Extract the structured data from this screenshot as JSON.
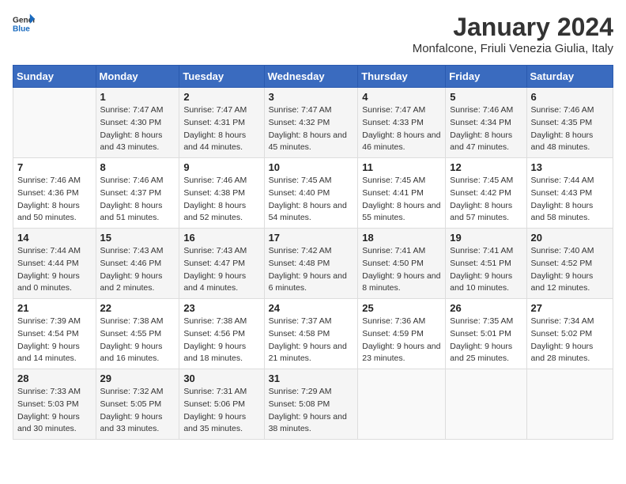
{
  "header": {
    "logo_general": "General",
    "logo_blue": "Blue",
    "title": "January 2024",
    "subtitle": "Monfalcone, Friuli Venezia Giulia, Italy"
  },
  "weekdays": [
    "Sunday",
    "Monday",
    "Tuesday",
    "Wednesday",
    "Thursday",
    "Friday",
    "Saturday"
  ],
  "weeks": [
    [
      {
        "day": "",
        "sunrise": "",
        "sunset": "",
        "daylight": ""
      },
      {
        "day": "1",
        "sunrise": "Sunrise: 7:47 AM",
        "sunset": "Sunset: 4:30 PM",
        "daylight": "Daylight: 8 hours and 43 minutes."
      },
      {
        "day": "2",
        "sunrise": "Sunrise: 7:47 AM",
        "sunset": "Sunset: 4:31 PM",
        "daylight": "Daylight: 8 hours and 44 minutes."
      },
      {
        "day": "3",
        "sunrise": "Sunrise: 7:47 AM",
        "sunset": "Sunset: 4:32 PM",
        "daylight": "Daylight: 8 hours and 45 minutes."
      },
      {
        "day": "4",
        "sunrise": "Sunrise: 7:47 AM",
        "sunset": "Sunset: 4:33 PM",
        "daylight": "Daylight: 8 hours and 46 minutes."
      },
      {
        "day": "5",
        "sunrise": "Sunrise: 7:46 AM",
        "sunset": "Sunset: 4:34 PM",
        "daylight": "Daylight: 8 hours and 47 minutes."
      },
      {
        "day": "6",
        "sunrise": "Sunrise: 7:46 AM",
        "sunset": "Sunset: 4:35 PM",
        "daylight": "Daylight: 8 hours and 48 minutes."
      }
    ],
    [
      {
        "day": "7",
        "sunrise": "Sunrise: 7:46 AM",
        "sunset": "Sunset: 4:36 PM",
        "daylight": "Daylight: 8 hours and 50 minutes."
      },
      {
        "day": "8",
        "sunrise": "Sunrise: 7:46 AM",
        "sunset": "Sunset: 4:37 PM",
        "daylight": "Daylight: 8 hours and 51 minutes."
      },
      {
        "day": "9",
        "sunrise": "Sunrise: 7:46 AM",
        "sunset": "Sunset: 4:38 PM",
        "daylight": "Daylight: 8 hours and 52 minutes."
      },
      {
        "day": "10",
        "sunrise": "Sunrise: 7:45 AM",
        "sunset": "Sunset: 4:40 PM",
        "daylight": "Daylight: 8 hours and 54 minutes."
      },
      {
        "day": "11",
        "sunrise": "Sunrise: 7:45 AM",
        "sunset": "Sunset: 4:41 PM",
        "daylight": "Daylight: 8 hours and 55 minutes."
      },
      {
        "day": "12",
        "sunrise": "Sunrise: 7:45 AM",
        "sunset": "Sunset: 4:42 PM",
        "daylight": "Daylight: 8 hours and 57 minutes."
      },
      {
        "day": "13",
        "sunrise": "Sunrise: 7:44 AM",
        "sunset": "Sunset: 4:43 PM",
        "daylight": "Daylight: 8 hours and 58 minutes."
      }
    ],
    [
      {
        "day": "14",
        "sunrise": "Sunrise: 7:44 AM",
        "sunset": "Sunset: 4:44 PM",
        "daylight": "Daylight: 9 hours and 0 minutes."
      },
      {
        "day": "15",
        "sunrise": "Sunrise: 7:43 AM",
        "sunset": "Sunset: 4:46 PM",
        "daylight": "Daylight: 9 hours and 2 minutes."
      },
      {
        "day": "16",
        "sunrise": "Sunrise: 7:43 AM",
        "sunset": "Sunset: 4:47 PM",
        "daylight": "Daylight: 9 hours and 4 minutes."
      },
      {
        "day": "17",
        "sunrise": "Sunrise: 7:42 AM",
        "sunset": "Sunset: 4:48 PM",
        "daylight": "Daylight: 9 hours and 6 minutes."
      },
      {
        "day": "18",
        "sunrise": "Sunrise: 7:41 AM",
        "sunset": "Sunset: 4:50 PM",
        "daylight": "Daylight: 9 hours and 8 minutes."
      },
      {
        "day": "19",
        "sunrise": "Sunrise: 7:41 AM",
        "sunset": "Sunset: 4:51 PM",
        "daylight": "Daylight: 9 hours and 10 minutes."
      },
      {
        "day": "20",
        "sunrise": "Sunrise: 7:40 AM",
        "sunset": "Sunset: 4:52 PM",
        "daylight": "Daylight: 9 hours and 12 minutes."
      }
    ],
    [
      {
        "day": "21",
        "sunrise": "Sunrise: 7:39 AM",
        "sunset": "Sunset: 4:54 PM",
        "daylight": "Daylight: 9 hours and 14 minutes."
      },
      {
        "day": "22",
        "sunrise": "Sunrise: 7:38 AM",
        "sunset": "Sunset: 4:55 PM",
        "daylight": "Daylight: 9 hours and 16 minutes."
      },
      {
        "day": "23",
        "sunrise": "Sunrise: 7:38 AM",
        "sunset": "Sunset: 4:56 PM",
        "daylight": "Daylight: 9 hours and 18 minutes."
      },
      {
        "day": "24",
        "sunrise": "Sunrise: 7:37 AM",
        "sunset": "Sunset: 4:58 PM",
        "daylight": "Daylight: 9 hours and 21 minutes."
      },
      {
        "day": "25",
        "sunrise": "Sunrise: 7:36 AM",
        "sunset": "Sunset: 4:59 PM",
        "daylight": "Daylight: 9 hours and 23 minutes."
      },
      {
        "day": "26",
        "sunrise": "Sunrise: 7:35 AM",
        "sunset": "Sunset: 5:01 PM",
        "daylight": "Daylight: 9 hours and 25 minutes."
      },
      {
        "day": "27",
        "sunrise": "Sunrise: 7:34 AM",
        "sunset": "Sunset: 5:02 PM",
        "daylight": "Daylight: 9 hours and 28 minutes."
      }
    ],
    [
      {
        "day": "28",
        "sunrise": "Sunrise: 7:33 AM",
        "sunset": "Sunset: 5:03 PM",
        "daylight": "Daylight: 9 hours and 30 minutes."
      },
      {
        "day": "29",
        "sunrise": "Sunrise: 7:32 AM",
        "sunset": "Sunset: 5:05 PM",
        "daylight": "Daylight: 9 hours and 33 minutes."
      },
      {
        "day": "30",
        "sunrise": "Sunrise: 7:31 AM",
        "sunset": "Sunset: 5:06 PM",
        "daylight": "Daylight: 9 hours and 35 minutes."
      },
      {
        "day": "31",
        "sunrise": "Sunrise: 7:29 AM",
        "sunset": "Sunset: 5:08 PM",
        "daylight": "Daylight: 9 hours and 38 minutes."
      },
      {
        "day": "",
        "sunrise": "",
        "sunset": "",
        "daylight": ""
      },
      {
        "day": "",
        "sunrise": "",
        "sunset": "",
        "daylight": ""
      },
      {
        "day": "",
        "sunrise": "",
        "sunset": "",
        "daylight": ""
      }
    ]
  ]
}
